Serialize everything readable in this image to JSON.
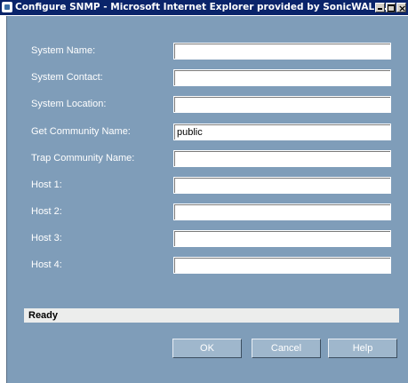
{
  "window": {
    "title": "Configure SNMP - Microsoft Internet Explorer provided by SonicWALL..."
  },
  "form": {
    "fields": [
      {
        "label": "System Name:",
        "value": ""
      },
      {
        "label": "System Contact:",
        "value": ""
      },
      {
        "label": "System Location:",
        "value": ""
      },
      {
        "label": "Get Community Name:",
        "value": "public"
      },
      {
        "label": "Trap Community Name:",
        "value": ""
      },
      {
        "label": "Host 1:",
        "value": ""
      },
      {
        "label": "Host 2:",
        "value": ""
      },
      {
        "label": "Host 3:",
        "value": ""
      },
      {
        "label": "Host 4:",
        "value": ""
      }
    ]
  },
  "status": {
    "text": "Ready"
  },
  "buttons": {
    "ok": "OK",
    "cancel": "Cancel",
    "help": "Help"
  },
  "colors": {
    "titlebar": "#0a246a",
    "panel": "#7f9db9",
    "button": "#9fb7cc",
    "status_bg": "#ecedec"
  }
}
